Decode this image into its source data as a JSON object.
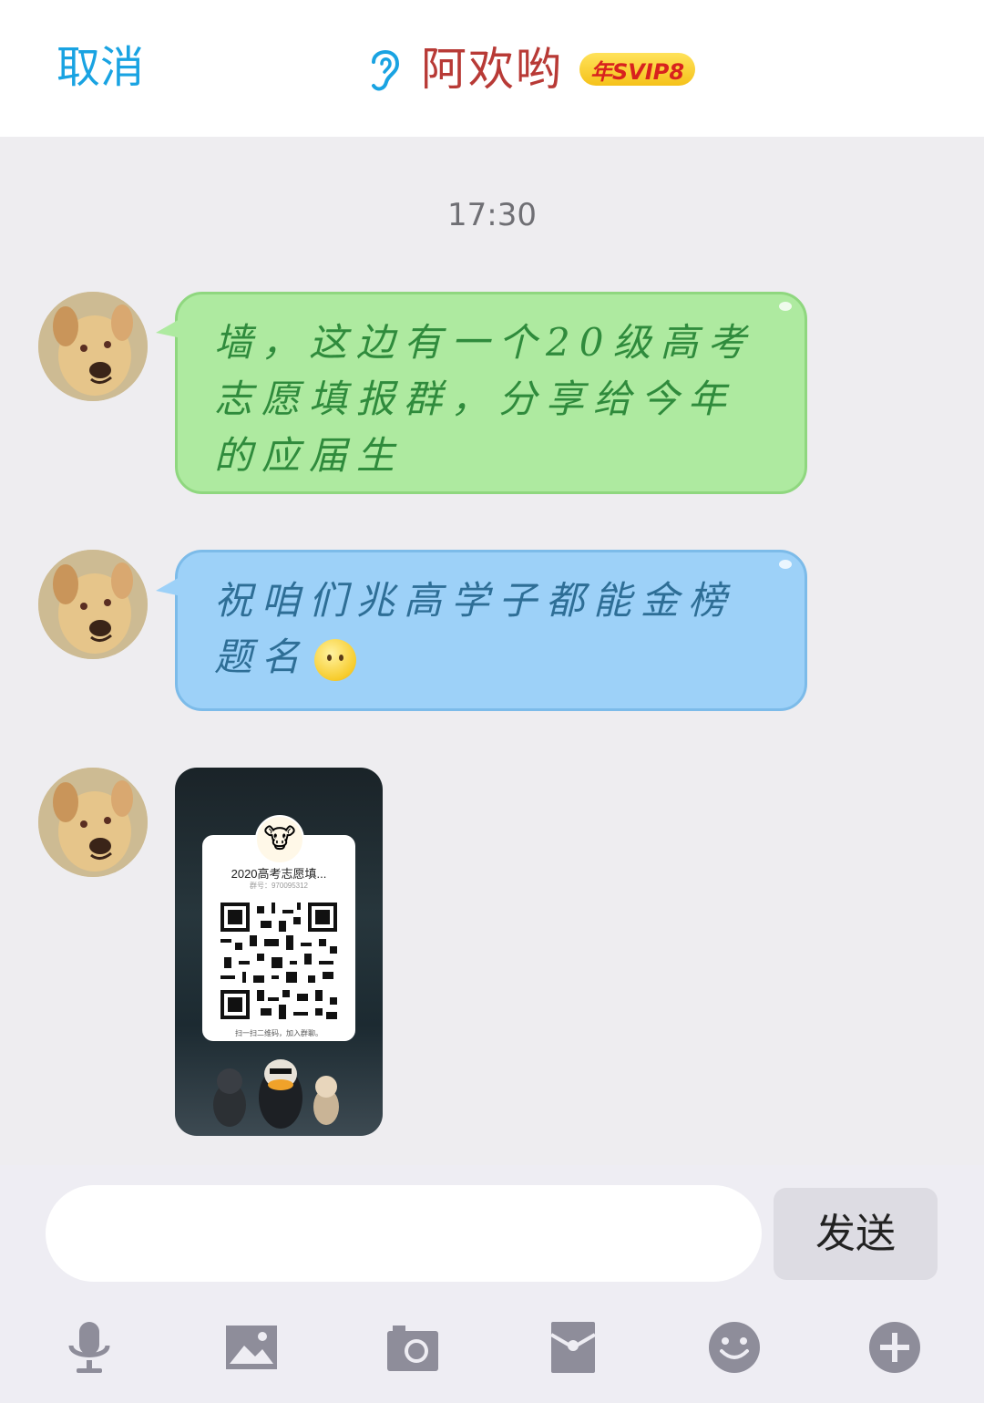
{
  "header": {
    "cancel_label": "取消",
    "contact_name": "阿欢哟",
    "vip_badge": "年SVIP8",
    "icons": {
      "ear": "ear-icon"
    }
  },
  "chat": {
    "timestamp": "17:30",
    "messages": [
      {
        "type": "text",
        "color": "#aeeaa0",
        "text": "墙，这边有一个20级高考志愿填报群，分享给今年的应届生"
      },
      {
        "type": "text",
        "color": "#9dd1f8",
        "text": "祝咱们兆高学子都能金榜题名",
        "emoji": "blush-face-emoji"
      },
      {
        "type": "image",
        "qr_card": {
          "title": "2020高考志愿填...",
          "group_number": "群号：970095312",
          "footer": "扫一扫二维码，加入群聊。"
        }
      }
    ]
  },
  "input_bar": {
    "input_value": "",
    "send_label": "发送",
    "toolbar": [
      "microphone-icon",
      "image-icon",
      "camera-icon",
      "red-packet-icon",
      "emoji-icon",
      "plus-icon"
    ]
  },
  "colors": {
    "accent_blue": "#19a3e2",
    "title_red": "#b83a36",
    "icon_gray": "#8e8d9a"
  }
}
